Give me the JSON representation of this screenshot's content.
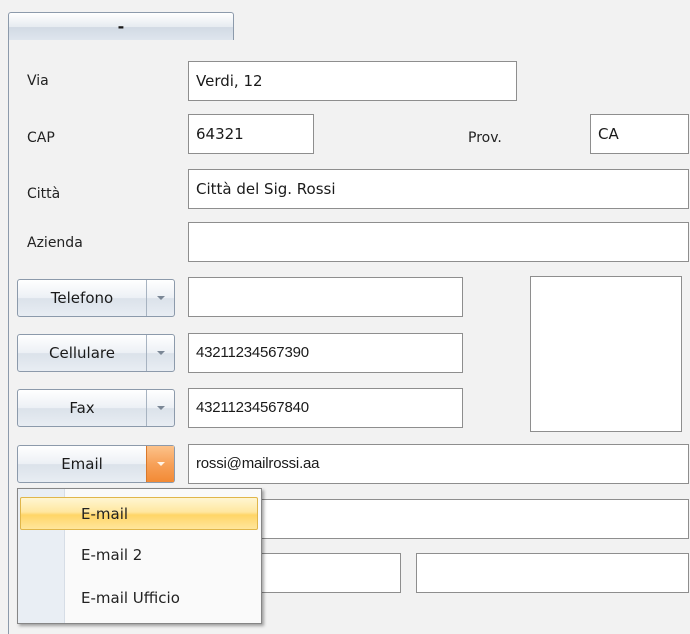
{
  "tab": {
    "label": "-"
  },
  "labels": {
    "via": "Via",
    "cap": "CAP",
    "prov": "Prov.",
    "citta": "Città",
    "azienda": "Azienda"
  },
  "fields": {
    "via": "Verdi, 12",
    "cap": "64321",
    "prov": "CA",
    "citta": "Città del Sig. Rossi",
    "azienda": "",
    "telefono": "",
    "cellulare": "43211234567390",
    "fax": "43211234567840",
    "email": "rossi@mailrossi.aa",
    "email_extra": "",
    "extra_left": "",
    "extra_right": ""
  },
  "contact_types": {
    "telefono": "Telefono",
    "cellulare": "Cellulare",
    "fax": "Fax",
    "email": "Email"
  },
  "email_menu": {
    "items": [
      "E-mail",
      "E-mail 2",
      "E-mail Ufficio"
    ],
    "selected": "E-mail"
  },
  "colors": {
    "accent_orange": "#f7a159",
    "menu_highlight": "#ffe08a"
  }
}
